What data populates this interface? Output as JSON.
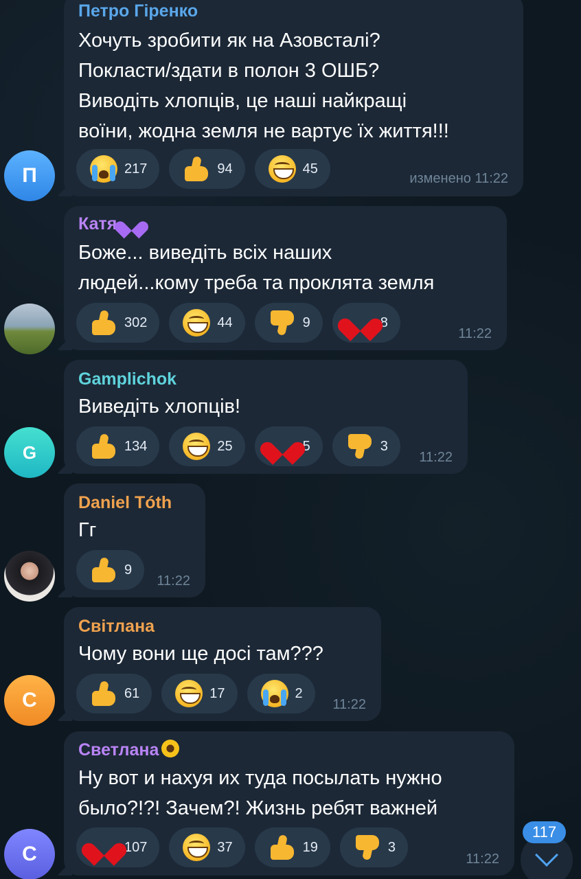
{
  "messages": [
    {
      "author": "Петро Гіренко",
      "author_color": "#5aa7ea",
      "avatar_letter": "П",
      "text": "Хочуть зробити як на Азовсталі?\nПокласти/здати в полон 3 ОШБ?\nВиводіть хлопців, це наші найкращі\nвоїни, жодна земля не вартує їх життя!!!",
      "time": "изменено 11:22",
      "reactions": [
        {
          "emoji": "crying-face-icon",
          "count": "217"
        },
        {
          "emoji": "thumbs-up-icon",
          "count": "94"
        },
        {
          "emoji": "grinning-face-icon",
          "count": "45"
        }
      ]
    },
    {
      "author": "Катя",
      "author_color": "#b984f5",
      "author_emoji": "purple-heart-icon",
      "avatar": "photo-landscape",
      "text": "Боже... виведіть всіх наших\nлюдей...кому треба та проклята земля",
      "time": "11:22",
      "reactions": [
        {
          "emoji": "thumbs-up-icon",
          "count": "302"
        },
        {
          "emoji": "grinning-face-icon",
          "count": "44"
        },
        {
          "emoji": "thumbs-down-icon",
          "count": "9"
        },
        {
          "emoji": "red-heart-icon",
          "count": "8"
        }
      ]
    },
    {
      "author": "Gamplichok",
      "author_color": "#5fd3dc",
      "avatar_letter": "G",
      "text": "Виведіть хлопців!",
      "time": "11:22",
      "reactions": [
        {
          "emoji": "thumbs-up-icon",
          "count": "134"
        },
        {
          "emoji": "grinning-face-icon",
          "count": "25"
        },
        {
          "emoji": "red-heart-icon",
          "count": "5"
        },
        {
          "emoji": "thumbs-down-icon",
          "count": "3"
        }
      ]
    },
    {
      "author": "Daniel Tóth",
      "author_color": "#f0a24e",
      "avatar": "photo-portrait",
      "text": "Гг",
      "time": "11:22",
      "reactions": [
        {
          "emoji": "thumbs-up-icon",
          "count": "9"
        }
      ]
    },
    {
      "author": "Світлана",
      "author_color": "#f0a24e",
      "avatar_letter": "С",
      "text": "Чому вони ще досі там???",
      "time": "11:22",
      "reactions": [
        {
          "emoji": "thumbs-up-icon",
          "count": "61"
        },
        {
          "emoji": "grinning-face-icon",
          "count": "17"
        },
        {
          "emoji": "crying-face-icon",
          "count": "2"
        }
      ]
    },
    {
      "author": "Светлана",
      "author_color": "#b984f5",
      "author_emoji": "sunflower-icon",
      "avatar_letter": "С",
      "text": "Ну вот и нахуя их туда посылать нужно\nбыло?!?! Зачем?! Жизнь ребят важней",
      "time": "11:22",
      "reactions": [
        {
          "emoji": "red-heart-icon",
          "count": "107"
        },
        {
          "emoji": "grinning-face-icon",
          "count": "37"
        },
        {
          "emoji": "thumbs-up-icon",
          "count": "19"
        },
        {
          "emoji": "thumbs-down-icon",
          "count": "3"
        }
      ]
    }
  ],
  "scroll_button": {
    "unread_count": "117",
    "icon": "chevron-down-icon"
  }
}
